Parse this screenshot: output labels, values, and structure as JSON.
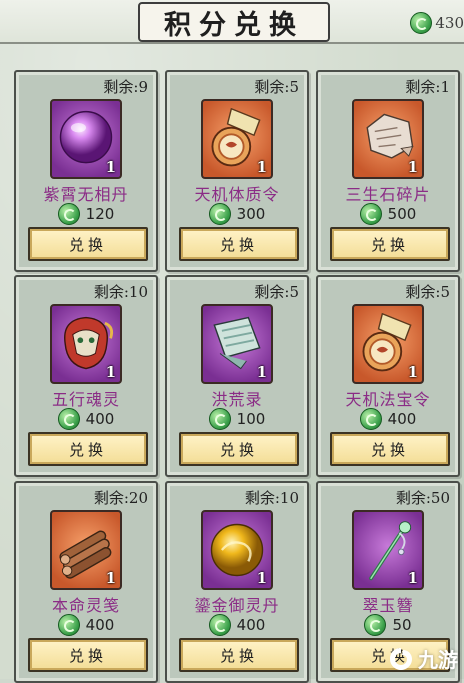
{
  "header": {
    "title": "积分兑换",
    "points_value": "430"
  },
  "items": [
    {
      "remaining_label": "剩余:9",
      "name": "紫霄无相丹",
      "cost": "120",
      "qty": "1",
      "icon": "purple-orb-icon",
      "bg": "purple",
      "button": "兑换"
    },
    {
      "remaining_label": "剩余:5",
      "name": "天机体质令",
      "cost": "300",
      "qty": "1",
      "icon": "bronze-token-icon",
      "bg": "orange",
      "button": "兑换"
    },
    {
      "remaining_label": "剩余:1",
      "name": "三生石碎片",
      "cost": "500",
      "qty": "1",
      "icon": "stone-fragment-icon",
      "bg": "orange",
      "button": "兑换"
    },
    {
      "remaining_label": "剩余:10",
      "name": "五行魂灵",
      "cost": "400",
      "qty": "1",
      "icon": "spirit-mask-icon",
      "bg": "purple",
      "button": "兑换"
    },
    {
      "remaining_label": "剩余:5",
      "name": "洪荒录",
      "cost": "100",
      "qty": "1",
      "icon": "scroll-book-icon",
      "bg": "purple",
      "button": "兑换"
    },
    {
      "remaining_label": "剩余:5",
      "name": "天机法宝令",
      "cost": "400",
      "qty": "1",
      "icon": "bronze-token-icon",
      "bg": "orange",
      "button": "兑换"
    },
    {
      "remaining_label": "剩余:20",
      "name": "本命灵笺",
      "cost": "400",
      "qty": "1",
      "icon": "bamboo-bundle-icon",
      "bg": "orange",
      "button": "兑换"
    },
    {
      "remaining_label": "剩余:10",
      "name": "鎏金御灵丹",
      "cost": "400",
      "qty": "1",
      "icon": "golden-orb-icon",
      "bg": "purple",
      "button": "兑换"
    },
    {
      "remaining_label": "剩余:50",
      "name": "翠玉簪",
      "cost": "50",
      "qty": "1",
      "icon": "jade-hairpin-icon",
      "bg": "purple",
      "button": "兑换"
    }
  ],
  "watermark": {
    "text": "九游"
  },
  "colors": {
    "item_name": "#8b2c86",
    "button_fill": "#f3dd96",
    "card_bg": "#bcc8bc"
  }
}
